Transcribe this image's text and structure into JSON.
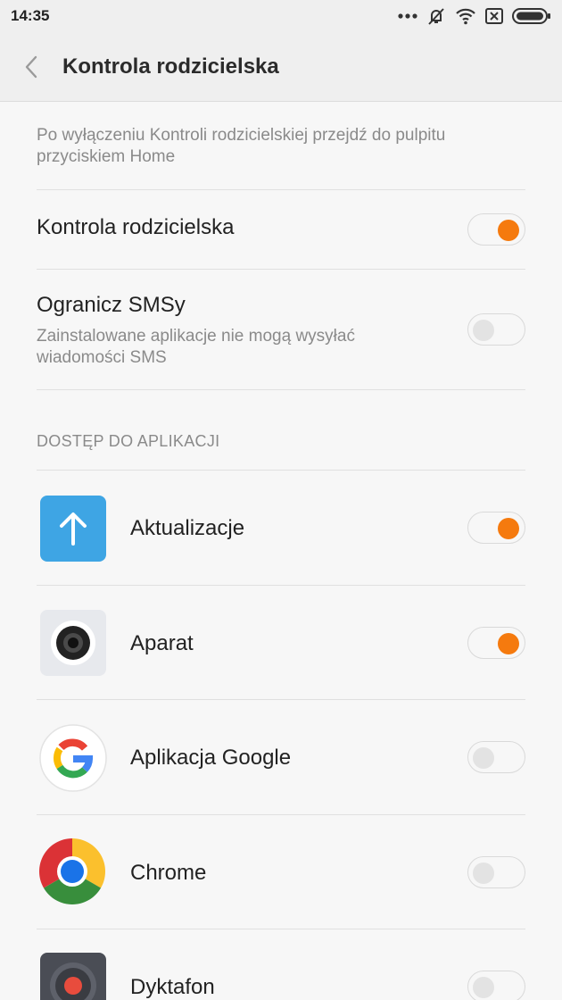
{
  "status": {
    "time": "14:35"
  },
  "header": {
    "title": "Kontrola rodzicielska"
  },
  "note": "Po wyłączeniu Kontroli rodzicielskiej przejdź do pulpitu przyciskiem Home",
  "settings": [
    {
      "title": "Kontrola rodzicielska",
      "enabled": true
    },
    {
      "title": "Ogranicz SMSy",
      "subtitle": "Zainstalowane aplikacje nie mogą wysyłać wiadomości SMS",
      "enabled": false
    }
  ],
  "section_label": "DOSTĘP DO APLIKACJI",
  "apps": [
    {
      "name": "Aktualizacje",
      "icon": "update-arrow-icon",
      "enabled": true
    },
    {
      "name": "Aparat",
      "icon": "camera-icon",
      "enabled": true
    },
    {
      "name": "Aplikacja Google",
      "icon": "google-icon",
      "enabled": false
    },
    {
      "name": "Chrome",
      "icon": "chrome-icon",
      "enabled": false
    },
    {
      "name": "Dyktafon",
      "icon": "recorder-icon",
      "enabled": false
    }
  ],
  "colors": {
    "accent": "#f57a0e",
    "background": "#f7f7f7",
    "header": "#efefef",
    "secondary_text": "#8a8a8a"
  }
}
